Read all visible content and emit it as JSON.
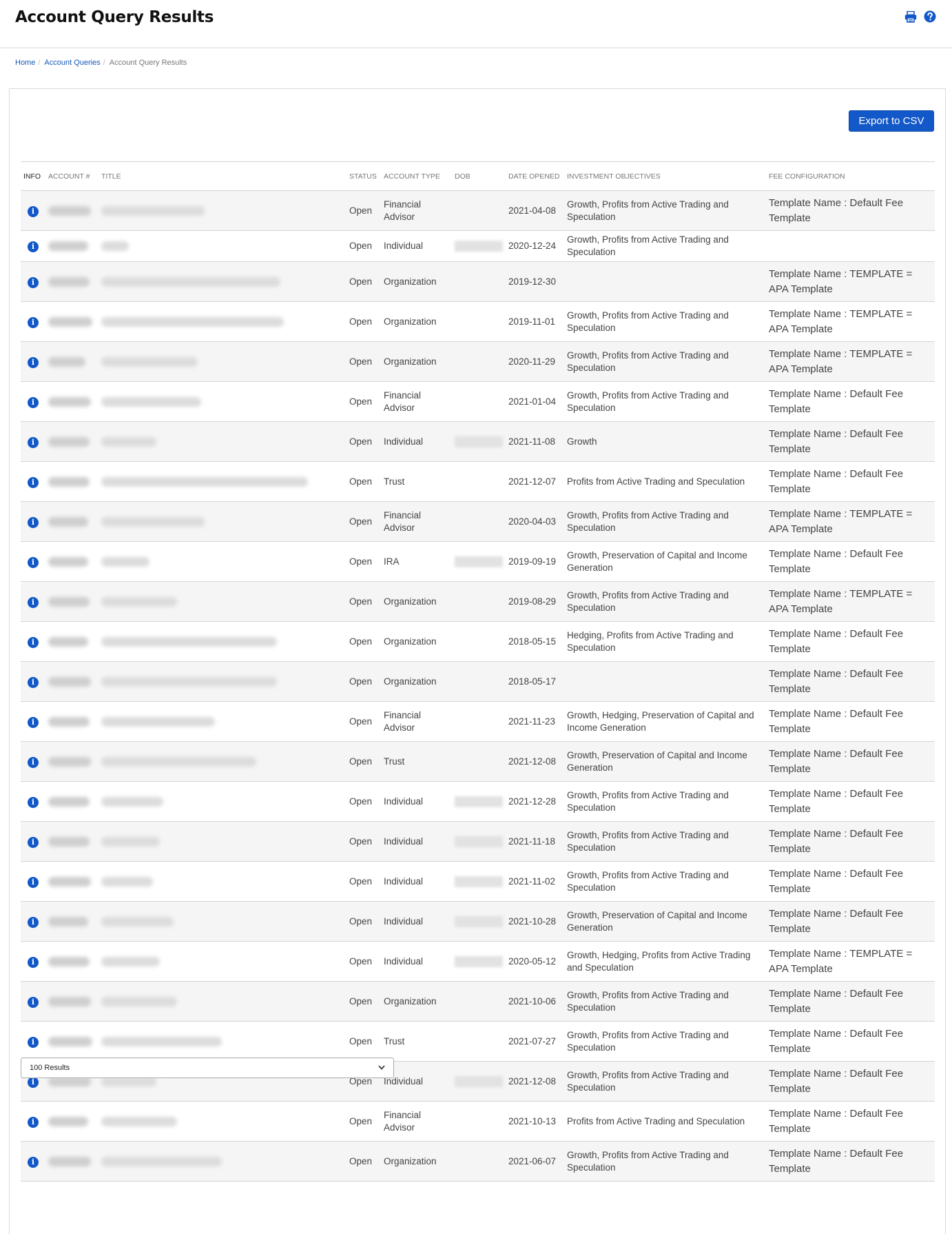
{
  "page": {
    "title": "Account Query Results",
    "icons": [
      "print-icon",
      "help-icon"
    ]
  },
  "breadcrumb": {
    "home": "Home",
    "queries": "Account Queries",
    "current": "Account Query Results",
    "separator": "/"
  },
  "toolbar": {
    "export_label": "Export to CSV"
  },
  "table": {
    "headers": {
      "info": "INFO",
      "account": "ACCOUNT #",
      "title": "TITLE",
      "status": "STATUS",
      "type": "ACCOUNT TYPE",
      "dob": "DOB",
      "opened": "DATE OPENED",
      "objectives": "INVESTMENT OBJECTIVES",
      "fee": "FEE CONFIGURATION"
    },
    "rows": [
      {
        "status": "Open",
        "type": "Financial Advisor",
        "dob": "",
        "opened": "2021-04-08",
        "objectives": "Growth, Profits from Active Trading and Speculation",
        "fee": "Template Name : Default Fee Template"
      },
      {
        "status": "Open",
        "type": "Individual",
        "dob": "blurred",
        "opened": "2020-12-24",
        "objectives": "Growth, Profits from Active Trading and Speculation",
        "fee": ""
      },
      {
        "status": "Open",
        "type": "Organization",
        "dob": "",
        "opened": "2019-12-30",
        "objectives": "",
        "fee": "Template Name : TEMPLATE = APA Template"
      },
      {
        "status": "Open",
        "type": "Organization",
        "dob": "",
        "opened": "2019-11-01",
        "objectives": "Growth, Profits from Active Trading and Speculation",
        "fee": "Template Name : TEMPLATE = APA Template"
      },
      {
        "status": "Open",
        "type": "Organization",
        "dob": "",
        "opened": "2020-11-29",
        "objectives": "Growth, Profits from Active Trading and Speculation",
        "fee": "Template Name : TEMPLATE = APA Template"
      },
      {
        "status": "Open",
        "type": "Financial Advisor",
        "dob": "",
        "opened": "2021-01-04",
        "objectives": "Growth, Profits from Active Trading and Speculation",
        "fee": "Template Name : Default Fee Template"
      },
      {
        "status": "Open",
        "type": "Individual",
        "dob": "blurred",
        "opened": "2021-11-08",
        "objectives": "Growth",
        "fee": "Template Name : Default Fee Template"
      },
      {
        "status": "Open",
        "type": "Trust",
        "dob": "",
        "opened": "2021-12-07",
        "objectives": "Profits from Active Trading and Speculation",
        "fee": "Template Name : Default Fee Template"
      },
      {
        "status": "Open",
        "type": "Financial Advisor",
        "dob": "",
        "opened": "2020-04-03",
        "objectives": "Growth, Profits from Active Trading and Speculation",
        "fee": "Template Name : TEMPLATE = APA Template"
      },
      {
        "status": "Open",
        "type": "IRA",
        "dob": "blurred",
        "opened": "2019-09-19",
        "objectives": "Growth, Preservation of Capital and Income Generation",
        "fee": "Template Name : Default Fee Template"
      },
      {
        "status": "Open",
        "type": "Organization",
        "dob": "",
        "opened": "2019-08-29",
        "objectives": "Growth, Profits from Active Trading and Speculation",
        "fee": "Template Name : TEMPLATE = APA Template"
      },
      {
        "status": "Open",
        "type": "Organization",
        "dob": "",
        "opened": "2018-05-15",
        "objectives": "Hedging, Profits from Active Trading and Speculation",
        "fee": "Template Name : Default Fee Template"
      },
      {
        "status": "Open",
        "type": "Organization",
        "dob": "",
        "opened": "2018-05-17",
        "objectives": "",
        "fee": "Template Name : Default Fee Template"
      },
      {
        "status": "Open",
        "type": "Financial Advisor",
        "dob": "",
        "opened": "2021-11-23",
        "objectives": "Growth, Hedging, Preservation of Capital and Income Generation",
        "fee": "Template Name : Default Fee Template"
      },
      {
        "status": "Open",
        "type": "Trust",
        "dob": "",
        "opened": "2021-12-08",
        "objectives": "Growth, Preservation of Capital and Income Generation",
        "fee": "Template Name : Default Fee Template"
      },
      {
        "status": "Open",
        "type": "Individual",
        "dob": "blurred",
        "opened": "2021-12-28",
        "objectives": "Growth, Profits from Active Trading and Speculation",
        "fee": "Template Name : Default Fee Template"
      },
      {
        "status": "Open",
        "type": "Individual",
        "dob": "blurred",
        "opened": "2021-11-18",
        "objectives": "Growth, Profits from Active Trading and Speculation",
        "fee": "Template Name : Default Fee Template"
      },
      {
        "status": "Open",
        "type": "Individual",
        "dob": "blurred",
        "opened": "2021-11-02",
        "objectives": "Growth, Profits from Active Trading and Speculation",
        "fee": "Template Name : Default Fee Template"
      },
      {
        "status": "Open",
        "type": "Individual",
        "dob": "blurred",
        "opened": "2021-10-28",
        "objectives": "Growth, Preservation of Capital and Income Generation",
        "fee": "Template Name : Default Fee Template"
      },
      {
        "status": "Open",
        "type": "Individual",
        "dob": "blurred",
        "opened": "2020-05-12",
        "objectives": "Growth, Hedging, Profits from Active Trading and Speculation",
        "fee": "Template Name : TEMPLATE = APA Template"
      },
      {
        "status": "Open",
        "type": "Organization",
        "dob": "",
        "opened": "2021-10-06",
        "objectives": "Growth, Profits from Active Trading and Speculation",
        "fee": "Template Name : Default Fee Template"
      },
      {
        "status": "Open",
        "type": "Trust",
        "dob": "",
        "opened": "2021-07-27",
        "objectives": "Growth, Profits from Active Trading and Speculation",
        "fee": "Template Name : Default Fee Template"
      },
      {
        "status": "Open",
        "type": "Individual",
        "dob": "blurred",
        "opened": "2021-12-08",
        "objectives": "Growth, Profits from Active Trading and Speculation",
        "fee": "Template Name : Default Fee Template"
      },
      {
        "status": "Open",
        "type": "Financial Advisor",
        "dob": "",
        "opened": "2021-10-13",
        "objectives": "Profits from Active Trading and Speculation",
        "fee": "Template Name : Default Fee Template"
      },
      {
        "status": "Open",
        "type": "Organization",
        "dob": "",
        "opened": "2021-06-07",
        "objectives": "Growth, Profits from Active Trading and Speculation",
        "fee": "Template Name : Default Fee Template"
      }
    ]
  },
  "pagination": {
    "results_per_page": "100 Results"
  },
  "colors": {
    "accent": "#1358c8",
    "link": "#1358b7",
    "row_alt": "#f5f5f5"
  }
}
